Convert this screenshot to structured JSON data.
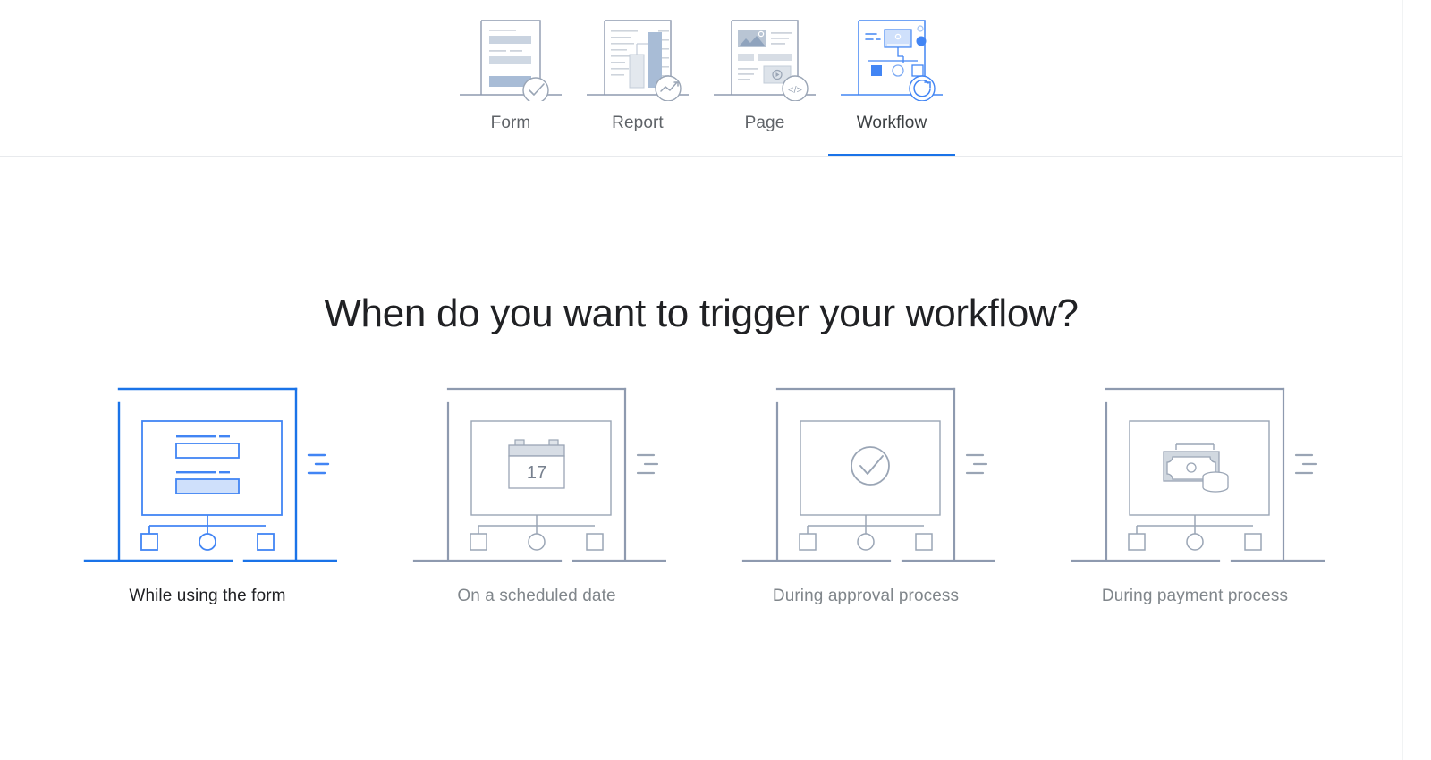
{
  "tabbar": {
    "tabs": [
      {
        "label": "Form",
        "icon": "form-document-icon",
        "active": false
      },
      {
        "label": "Report",
        "icon": "report-chart-icon",
        "active": false
      },
      {
        "label": "Page",
        "icon": "page-layout-icon",
        "active": false
      },
      {
        "label": "Workflow",
        "icon": "workflow-nodes-icon",
        "active": true
      }
    ]
  },
  "main": {
    "heading": "When do you want to trigger your workflow?",
    "options": [
      {
        "label": "While using the form",
        "icon": "form-trigger-icon",
        "selected": true
      },
      {
        "label": "On a scheduled date",
        "icon": "calendar-trigger-icon",
        "selected": false,
        "calendar_day": "17"
      },
      {
        "label": "During approval process",
        "icon": "approval-check-icon",
        "selected": false
      },
      {
        "label": "During payment process",
        "icon": "payment-money-icon",
        "selected": false
      }
    ]
  },
  "colors": {
    "accent": "#1a73e8",
    "accent_light": "#4285f4",
    "accent_fill": "#d7e5fb",
    "line_gray": "#8e9aaf",
    "fill_gray": "#ced4dc",
    "text_dark": "#202124",
    "text_muted": "#80868b",
    "tab_text": "#5f6368"
  }
}
